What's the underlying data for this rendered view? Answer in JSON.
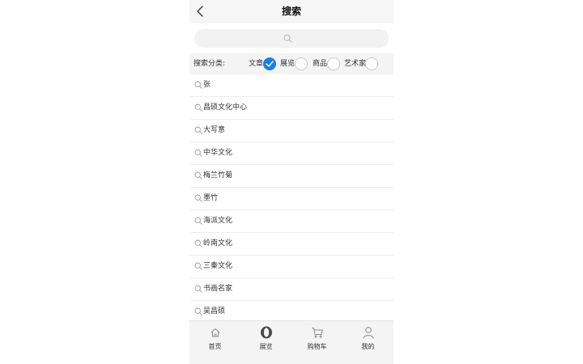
{
  "header": {
    "title": "搜索",
    "back_icon": "chevron-left-icon"
  },
  "search": {
    "placeholder": "",
    "value": "",
    "icon": "search-icon"
  },
  "category": {
    "label": "搜索分类:",
    "options": [
      {
        "label": "文章",
        "checked": true
      },
      {
        "label": "展览",
        "checked": false
      },
      {
        "label": "商品",
        "checked": false
      },
      {
        "label": "艺术家",
        "checked": false
      }
    ],
    "accent_color": "#1a7ee6"
  },
  "history": [
    "张",
    "昌硕文化中心",
    "大写意",
    "中华文化",
    "梅兰竹菊",
    "墨竹",
    "海派文化",
    "岭南文化",
    "三秦文化",
    "书画名家",
    "吴昌硕"
  ],
  "tabbar": [
    {
      "label": "首页",
      "icon": "home-icon"
    },
    {
      "label": "展览",
      "icon": "exhibition-icon"
    },
    {
      "label": "购物车",
      "icon": "cart-icon"
    },
    {
      "label": "我的",
      "icon": "user-icon"
    }
  ]
}
